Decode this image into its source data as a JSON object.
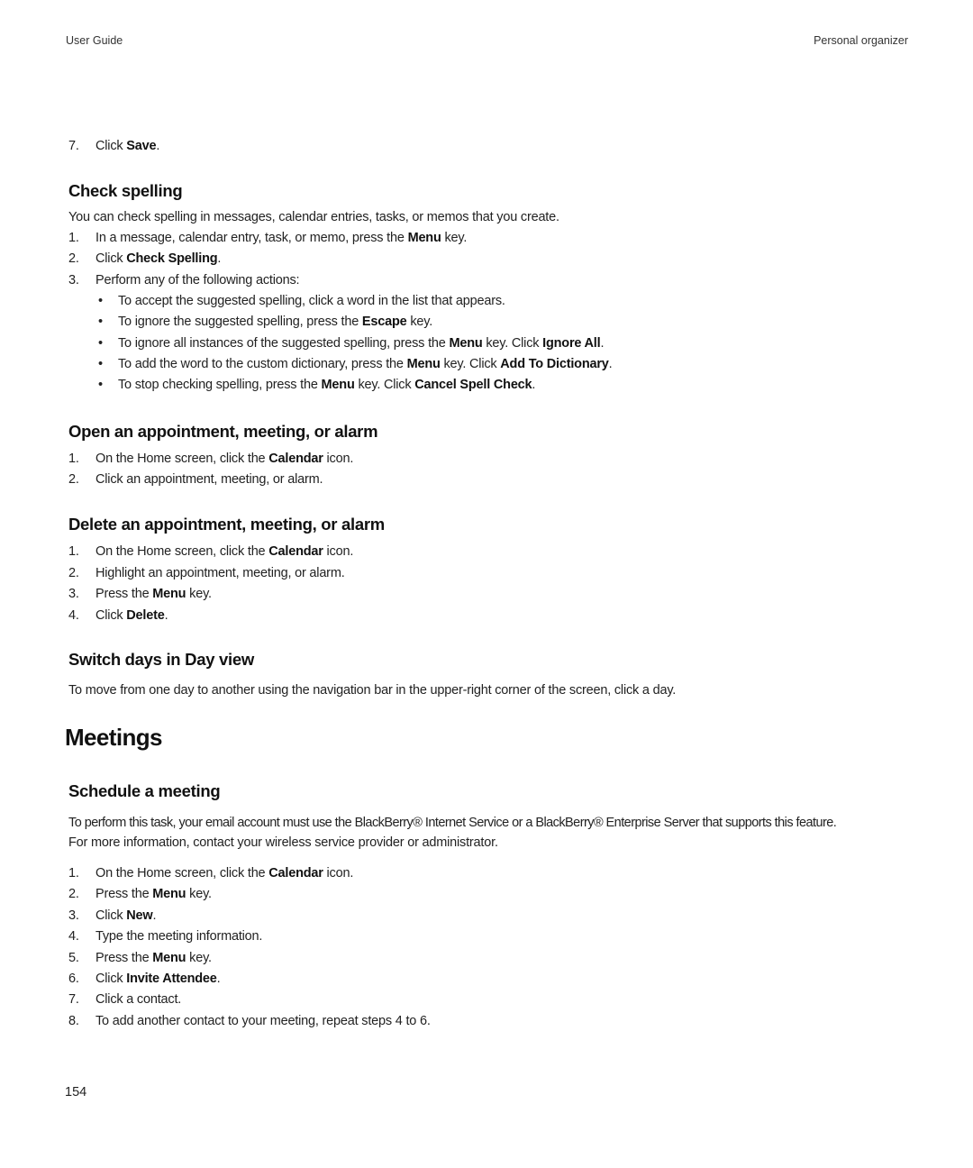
{
  "header": {
    "left": "User Guide",
    "right": "Personal organizer"
  },
  "prev_step": {
    "num": "7.",
    "pre": "Click ",
    "bold": "Save",
    "post": "."
  },
  "check_spelling": {
    "title": "Check spelling",
    "intro": "You can check spelling in messages, calendar entries, tasks, or memos that you create.",
    "steps": [
      {
        "num": "1.",
        "pre": "In a message, calendar entry, task, or memo, press the ",
        "bold": "Menu",
        "post": " key."
      },
      {
        "num": "2.",
        "pre": "Click ",
        "bold": "Check Spelling",
        "post": "."
      },
      {
        "num": "3.",
        "pre": "Perform any of the following actions:",
        "bold": "",
        "post": ""
      }
    ],
    "bullets": [
      {
        "a": "To accept the suggested spelling, click a word in the list that appears.",
        "b1": "",
        "c": "",
        "b2": "",
        "d": ""
      },
      {
        "a": "To ignore the suggested spelling, press the ",
        "b1": "Escape",
        "c": " key.",
        "b2": "",
        "d": ""
      },
      {
        "a": "To ignore all instances of the suggested spelling, press the ",
        "b1": "Menu",
        "c": " key. Click ",
        "b2": "Ignore All",
        "d": "."
      },
      {
        "a": "To add the word to the custom dictionary, press the ",
        "b1": "Menu",
        "c": " key. Click ",
        "b2": "Add To Dictionary",
        "d": "."
      },
      {
        "a": "To stop checking spelling, press the ",
        "b1": "Menu",
        "c": " key. Click ",
        "b2": "Cancel Spell Check",
        "d": "."
      }
    ]
  },
  "open_appt": {
    "title": "Open an appointment, meeting, or alarm",
    "steps": [
      {
        "num": "1.",
        "pre": "On the Home screen, click the ",
        "bold": "Calendar",
        "post": " icon."
      },
      {
        "num": "2.",
        "pre": "Click an appointment, meeting, or alarm.",
        "bold": "",
        "post": ""
      }
    ]
  },
  "delete_appt": {
    "title": "Delete an appointment, meeting, or alarm",
    "steps": [
      {
        "num": "1.",
        "pre": "On the Home screen, click the ",
        "bold": "Calendar",
        "post": " icon."
      },
      {
        "num": "2.",
        "pre": "Highlight an appointment, meeting, or alarm.",
        "bold": "",
        "post": ""
      },
      {
        "num": "3.",
        "pre": "Press the ",
        "bold": "Menu",
        "post": " key."
      },
      {
        "num": "4.",
        "pre": "Click ",
        "bold": "Delete",
        "post": "."
      }
    ]
  },
  "switch_days": {
    "title": "Switch days in Day view",
    "text": "To move from one day to another using the navigation bar in the upper-right corner of the screen, click a day."
  },
  "meetings": {
    "title": "Meetings"
  },
  "schedule": {
    "title": "Schedule a meeting",
    "intro_1": "To perform this task, your email account must use the BlackBerry® Internet Service or a BlackBerry® Enterprise Server that supports this feature.",
    "intro_2": "For more information, contact your wireless service provider or administrator.",
    "steps": [
      {
        "num": "1.",
        "pre": "On the Home screen, click the ",
        "bold": "Calendar",
        "post": " icon."
      },
      {
        "num": "2.",
        "pre": "Press the ",
        "bold": "Menu",
        "post": " key."
      },
      {
        "num": "3.",
        "pre": "Click ",
        "bold": "New",
        "post": "."
      },
      {
        "num": "4.",
        "pre": "Type the meeting information.",
        "bold": "",
        "post": ""
      },
      {
        "num": "5.",
        "pre": "Press the ",
        "bold": "Menu",
        "post": " key."
      },
      {
        "num": "6.",
        "pre": "Click ",
        "bold": "Invite Attendee",
        "post": "."
      },
      {
        "num": "7.",
        "pre": "Click a contact.",
        "bold": "",
        "post": ""
      },
      {
        "num": "8.",
        "pre": "To add another contact to your meeting, repeat steps 4 to 6.",
        "bold": "",
        "post": ""
      }
    ]
  },
  "footer": {
    "page_number": "154"
  }
}
